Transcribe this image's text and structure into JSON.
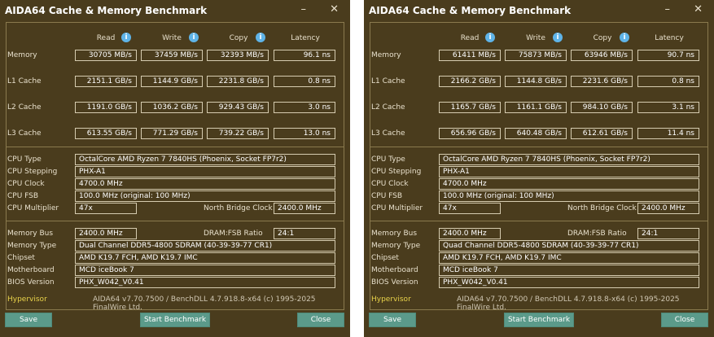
{
  "windows": [
    {
      "title": "AIDA64 Cache & Memory Benchmark",
      "columns": {
        "read": "Read",
        "write": "Write",
        "copy": "Copy",
        "latency": "Latency"
      },
      "rows": {
        "memory": {
          "label": "Memory",
          "read": "30705 MB/s",
          "write": "37459 MB/s",
          "copy": "32393 MB/s",
          "latency": "96.1 ns"
        },
        "l1": {
          "label": "L1 Cache",
          "read": "2151.1 GB/s",
          "write": "1144.9 GB/s",
          "copy": "2231.8 GB/s",
          "latency": "0.8 ns"
        },
        "l2": {
          "label": "L2 Cache",
          "read": "1191.0 GB/s",
          "write": "1036.2 GB/s",
          "copy": "929.43 GB/s",
          "latency": "3.0 ns"
        },
        "l3": {
          "label": "L3 Cache",
          "read": "613.55 GB/s",
          "write": "771.29 GB/s",
          "copy": "739.22 GB/s",
          "latency": "13.0 ns"
        }
      },
      "cpu": {
        "type_label": "CPU Type",
        "type": "OctalCore AMD Ryzen 7 7840HS  (Phoenix, Socket FP7r2)",
        "stepping_label": "CPU Stepping",
        "stepping": "PHX-A1",
        "clock_label": "CPU Clock",
        "clock": "4700.0 MHz",
        "fsb_label": "CPU FSB",
        "fsb": "100.0 MHz  (original: 100 MHz)",
        "mult_label": "CPU Multiplier",
        "mult": "47x",
        "nb_label": "North Bridge Clock",
        "nb": "2400.0 MHz"
      },
      "mem": {
        "bus_label": "Memory Bus",
        "bus": "2400.0 MHz",
        "ratio_label": "DRAM:FSB Ratio",
        "ratio": "24:1",
        "type_label": "Memory Type",
        "type": "Dual Channel DDR5-4800 SDRAM  (40-39-39-77 CR1)",
        "chipset_label": "Chipset",
        "chipset": "AMD K19.7 FCH, AMD K19.7 IMC",
        "mb_label": "Motherboard",
        "mb": "MCD iceBook 7",
        "bios_label": "BIOS Version",
        "bios": "PHX_W042_V0.41"
      },
      "hypervisor": "Hypervisor",
      "footer": "AIDA64 v7.70.7500 / BenchDLL 4.7.918.8-x64  (c) 1995-2025 FinalWire Ltd.",
      "buttons": {
        "save": "Save",
        "start": "Start Benchmark",
        "close": "Close"
      }
    },
    {
      "title": "AIDA64 Cache & Memory Benchmark",
      "columns": {
        "read": "Read",
        "write": "Write",
        "copy": "Copy",
        "latency": "Latency"
      },
      "rows": {
        "memory": {
          "label": "Memory",
          "read": "61411 MB/s",
          "write": "75873 MB/s",
          "copy": "63946 MB/s",
          "latency": "90.7 ns"
        },
        "l1": {
          "label": "L1 Cache",
          "read": "2166.2 GB/s",
          "write": "1144.8 GB/s",
          "copy": "2231.6 GB/s",
          "latency": "0.8 ns"
        },
        "l2": {
          "label": "L2 Cache",
          "read": "1165.7 GB/s",
          "write": "1161.1 GB/s",
          "copy": "984.10 GB/s",
          "latency": "3.1 ns"
        },
        "l3": {
          "label": "L3 Cache",
          "read": "656.96 GB/s",
          "write": "640.48 GB/s",
          "copy": "612.61 GB/s",
          "latency": "11.4 ns"
        }
      },
      "cpu": {
        "type_label": "CPU Type",
        "type": "OctalCore AMD Ryzen 7 7840HS  (Phoenix, Socket FP7r2)",
        "stepping_label": "CPU Stepping",
        "stepping": "PHX-A1",
        "clock_label": "CPU Clock",
        "clock": "4700.0 MHz",
        "fsb_label": "CPU FSB",
        "fsb": "100.0 MHz  (original: 100 MHz)",
        "mult_label": "CPU Multiplier",
        "mult": "47x",
        "nb_label": "North Bridge Clock",
        "nb": "2400.0 MHz"
      },
      "mem": {
        "bus_label": "Memory Bus",
        "bus": "2400.0 MHz",
        "ratio_label": "DRAM:FSB Ratio",
        "ratio": "24:1",
        "type_label": "Memory Type",
        "type": "Quad Channel DDR5-4800 SDRAM  (40-39-39-77 CR1)",
        "chipset_label": "Chipset",
        "chipset": "AMD K19.7 FCH, AMD K19.7 IMC",
        "mb_label": "Motherboard",
        "mb": "MCD iceBook 7",
        "bios_label": "BIOS Version",
        "bios": "PHX_W042_V0.41"
      },
      "hypervisor": "Hypervisor",
      "footer": "AIDA64 v7.70.7500 / BenchDLL 4.7.918.8-x64  (c) 1995-2025 FinalWire Ltd.",
      "buttons": {
        "save": "Save",
        "start": "Start Benchmark",
        "close": "Close"
      }
    }
  ]
}
